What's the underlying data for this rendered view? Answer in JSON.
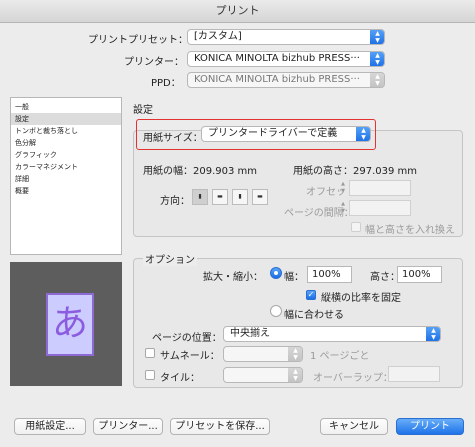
{
  "window": {
    "title": "プリント"
  },
  "header": {
    "preset_label": "プリントプリセット：",
    "preset_value": "[カスタム]",
    "printer_label": "プリンター：",
    "printer_value": "KONICA MINOLTA bizhub PRESS···",
    "ppd_label": "PPD：",
    "ppd_value": "KONICA MINOLTA bizhub PRESS···"
  },
  "sidebar": {
    "items": [
      {
        "label": "一般"
      },
      {
        "label": "設定"
      },
      {
        "label": "トンボと裁ち落とし"
      },
      {
        "label": "色分解"
      },
      {
        "label": "グラフィック"
      },
      {
        "label": "カラーマネジメント"
      },
      {
        "label": "詳細"
      },
      {
        "label": "概要"
      }
    ],
    "selected_index": 1
  },
  "preview": {
    "glyph": "あ"
  },
  "settings": {
    "section_title": "設定",
    "paper_size_label": "用紙サイズ：",
    "paper_size_value": "プリンタードライバーで定義",
    "width_label": "用紙の幅：209.903 mm",
    "height_label": "用紙の高さ：297.039 mm",
    "orientation_label": "方向：",
    "offset_label": "オフセット：",
    "gap_label": "ページの間隔：",
    "swap_label": "幅と高さを入れ換え"
  },
  "options": {
    "title": "オプション",
    "scale_label": "拡大・縮小：",
    "width_radio_label": "幅：",
    "width_value": "100%",
    "height_label": "高さ：",
    "height_value": "100%",
    "keep_ratio_label": "縦横の比率を固定",
    "fit_label": "幅に合わせる",
    "page_position_label": "ページの位置：",
    "page_position_value": "中央揃え",
    "thumbnail_label": "サムネール：",
    "thumbnail_suffix": "1 ページごと",
    "tile_label": "タイル：",
    "overlap_label": "オーバーラップ："
  },
  "footer": {
    "page_setup": "用紙設定...",
    "printer": "プリンター...",
    "save_preset": "プリセットを保存...",
    "cancel": "キャンセル",
    "print": "プリント"
  },
  "colors": {
    "accent": "#1a6ee6",
    "highlight_box": "#e23232",
    "preview_paper": "#ccccff",
    "preview_glyph": "#8b5ce0"
  }
}
